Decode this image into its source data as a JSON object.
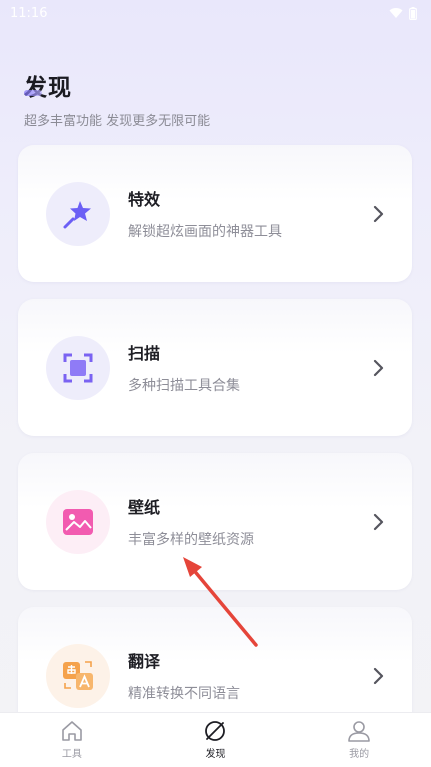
{
  "status_bar": {
    "time": "11:16",
    "icons": [
      "wifi-icon",
      "battery-icon"
    ]
  },
  "header": {
    "title": "发现",
    "subtitle": "超多丰富功能  发现更多无限可能"
  },
  "cards": [
    {
      "title": "特效",
      "desc": "解锁超炫画面的神器工具",
      "icon": "magic-wand-icon",
      "accent": "#6b5ff5"
    },
    {
      "title": "扫描",
      "desc": "多种扫描工具合集",
      "icon": "scan-icon",
      "accent": "#7a63f2"
    },
    {
      "title": "壁纸",
      "desc": "丰富多样的壁纸资源",
      "icon": "image-icon",
      "accent": "#f25bb0"
    },
    {
      "title": "翻译",
      "desc": "精准转换不同语言",
      "icon": "translate-icon",
      "accent": "#f5a24b"
    }
  ],
  "bottom_nav": [
    {
      "label": "工具",
      "icon": "home-icon",
      "active": false
    },
    {
      "label": "发现",
      "icon": "discover-icon",
      "active": true
    },
    {
      "label": "我的",
      "icon": "user-icon",
      "active": false
    }
  ],
  "colors": {
    "annotation_arrow": "#e5453a"
  }
}
